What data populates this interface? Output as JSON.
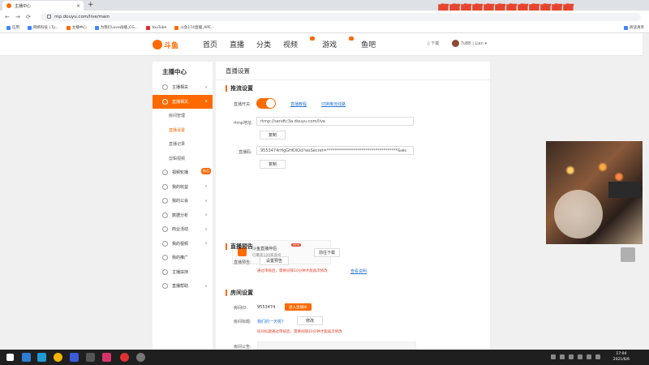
{
  "browser": {
    "tab_title": "主播中心",
    "url": "mp.douyu.com/live/main",
    "danmaku": "啊啊啊啊啊啊啊啊啊啊啊啊",
    "bookmarks": [
      "应用",
      "网络科技 | Ty...",
      "主播中心",
      "为我们Love再播_CG...",
      "YouTube",
      "斗鱼174直播_APE..."
    ],
    "reading_list": "阅读清单"
  },
  "header": {
    "logo": "斗鱼",
    "nav": [
      "首页",
      "直播",
      "分类",
      "视频",
      "游戏",
      "鱼吧"
    ],
    "download": "下载",
    "username": "TuBB | Lien"
  },
  "sidebar": {
    "title": "主播中心",
    "items": [
      {
        "label": "主播相关",
        "icon": "mic-icon"
      },
      {
        "label": "直播相关",
        "icon": "monitor-icon"
      },
      {
        "label": "房间管理"
      },
      {
        "label": "直播设置"
      },
      {
        "label": "直播记录"
      },
      {
        "label": "剪辑视频"
      },
      {
        "label": "视频轮播",
        "badge": "新品"
      },
      {
        "label": "我的收益"
      },
      {
        "label": "我的公会"
      },
      {
        "label": "数据分析"
      },
      {
        "label": "商业活动"
      },
      {
        "label": "我的视频"
      },
      {
        "label": "我的推广"
      },
      {
        "label": "主播扶持"
      },
      {
        "label": "直播帮助"
      }
    ]
  },
  "content": {
    "title": "直播设置",
    "push": {
      "heading": "推流设置",
      "switch_label": "直播开关:",
      "link1": "直播教程",
      "link2": "切换推流线路",
      "rtmp_label": "rtmp地址:",
      "rtmp_value": "rtmp://sendtc3a.douyu.com/live",
      "copy": "复制",
      "code_label": "直播码:",
      "code_value": "9553474rHgGH6XOd?wsSecret=***********************************&ws"
    },
    "promo": {
      "title": "斗鱼直播伴侣",
      "subtitle": "已覆盖120家高校",
      "new": "NEW",
      "download": "前往下载"
    },
    "preview": {
      "heading": "直播预告",
      "label": "直播预告:",
      "button": "设置预告",
      "warn": "通过审核后，需要间隔10分钟才能再次修改",
      "link": "查看说明"
    },
    "room": {
      "heading": "房间设置",
      "id_label": "房间ID:",
      "id_value": "9553474",
      "enter": "进入直播间",
      "title_label": "房间标题:",
      "title_value": "我们的一天呢?",
      "edit": "修改",
      "warn": "房间标题通过审核后，需要间隔10分钟才能再次修改",
      "notice_label": "房间公告:"
    }
  },
  "taskbar": {
    "time": "17:04",
    "date": "2021/6/6"
  }
}
